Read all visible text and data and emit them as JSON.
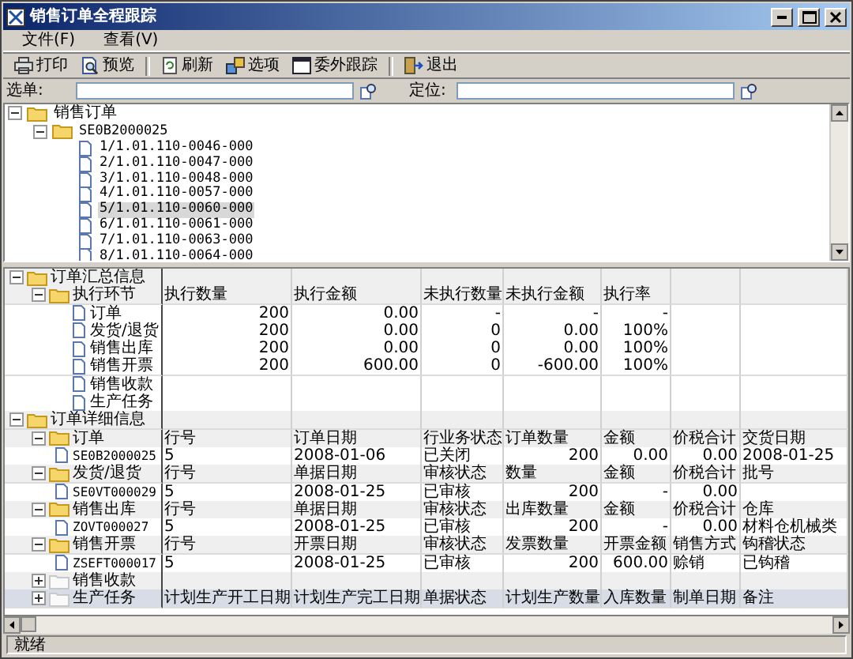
{
  "window": {
    "title": "销售订单全程跟踪"
  },
  "menu": [
    "文件(F)",
    "查看(V)"
  ],
  "toolbar": [
    {
      "label": "打印",
      "kind": "print"
    },
    {
      "label": "预览",
      "kind": "preview"
    },
    {
      "label": "刷新",
      "kind": "refresh"
    },
    {
      "label": "选项",
      "kind": "options"
    },
    {
      "label": "委外跟踪",
      "kind": "track"
    },
    {
      "label": "退出",
      "kind": "exit"
    }
  ],
  "filter": {
    "order_label": "选单:",
    "locate_label": "定位:"
  },
  "order_tree": {
    "label": "销售订单",
    "expanded": true,
    "children": [
      {
        "label": "SE0B2000025",
        "expanded": true,
        "children": [
          {
            "label": "1/1.01.110-0046-000",
            "selected": false
          },
          {
            "label": "2/1.01.110-0047-000",
            "selected": false
          },
          {
            "label": "3/1.01.110-0048-000",
            "selected": false
          },
          {
            "label": "4/1.01.110-0057-000",
            "selected": false
          },
          {
            "label": "5/1.01.110-0060-000",
            "selected": true
          },
          {
            "label": "6/1.01.110-0061-000",
            "selected": false
          },
          {
            "label": "7/1.01.110-0063-000",
            "selected": false
          },
          {
            "label": "8/1.01.110-0064-000",
            "selected": false
          }
        ]
      }
    ]
  },
  "summary": {
    "label": "订单汇总信息",
    "expanded": true,
    "stage": {
      "label": "执行环节",
      "expanded": true,
      "columns": [
        {
          "label": "执行数量",
          "numeric": true
        },
        {
          "label": "执行金额",
          "numeric": true
        },
        {
          "label": "未执行数量",
          "numeric": true
        },
        {
          "label": "未执行金额",
          "numeric": true
        },
        {
          "label": "执行率",
          "numeric": true
        }
      ],
      "rows": [
        {
          "label": "订单",
          "cells": [
            "200",
            "0.00",
            "-",
            "-",
            "-"
          ]
        },
        {
          "label": "发货/退货",
          "cells": [
            "200",
            "0.00",
            "0",
            "0.00",
            "100%"
          ]
        },
        {
          "label": "销售出库",
          "cells": [
            "200",
            "0.00",
            "0",
            "0.00",
            "100%"
          ]
        },
        {
          "label": "销售开票",
          "cells": [
            "200",
            "600.00",
            "0",
            "-600.00",
            "100%"
          ]
        },
        {
          "label": "销售收款"
        },
        {
          "label": "生产任务"
        }
      ]
    }
  },
  "details": {
    "label": "订单详细信息",
    "expanded": true,
    "groups": [
      {
        "label": "订单",
        "expanded": true,
        "selected": false,
        "columns": [
          {
            "label": "行号",
            "numeric": false
          },
          {
            "label": "订单日期",
            "numeric": false
          },
          {
            "label": "行业务状态",
            "numeric": false
          },
          {
            "label": "订单数量",
            "numeric": true
          },
          {
            "label": "金额",
            "numeric": true
          },
          {
            "label": "价税合计",
            "numeric": true
          },
          {
            "label": "交货日期",
            "numeric": false
          }
        ],
        "records": [
          {
            "label": "SE0B2000025",
            "cells": [
              "5",
              "2008-01-06",
              "已关闭",
              "200",
              "0.00",
              "0.00",
              "2008-01-25"
            ]
          }
        ]
      },
      {
        "label": "发货/退货",
        "expanded": true,
        "selected": false,
        "columns": [
          {
            "label": "行号",
            "numeric": false
          },
          {
            "label": "单据日期",
            "numeric": false
          },
          {
            "label": "审核状态",
            "numeric": false
          },
          {
            "label": "数量",
            "numeric": true
          },
          {
            "label": "金额",
            "numeric": true
          },
          {
            "label": "价税合计",
            "numeric": true
          },
          {
            "label": "批号",
            "numeric": false
          }
        ],
        "records": [
          {
            "label": "SE0VT000029",
            "cells": [
              "5",
              "2008-01-25",
              "已审核",
              "200",
              "-",
              "0.00",
              null
            ]
          }
        ]
      },
      {
        "label": "销售出库",
        "expanded": true,
        "selected": false,
        "columns": [
          {
            "label": "行号",
            "numeric": false
          },
          {
            "label": "单据日期",
            "numeric": false
          },
          {
            "label": "审核状态",
            "numeric": false
          },
          {
            "label": "出库数量",
            "numeric": true
          },
          {
            "label": "金额",
            "numeric": true
          },
          {
            "label": "价税合计",
            "numeric": true
          },
          {
            "label": "仓库",
            "numeric": false
          }
        ],
        "records": [
          {
            "label": "ZOVT000027",
            "cells": [
              "5",
              "2008-01-25",
              "已审核",
              "200",
              "-",
              "0.00",
              "材料仓机械类"
            ]
          }
        ]
      },
      {
        "label": "销售开票",
        "expanded": true,
        "selected": false,
        "columns": [
          {
            "label": "行号",
            "numeric": false
          },
          {
            "label": "开票日期",
            "numeric": false
          },
          {
            "label": "审核状态",
            "numeric": false
          },
          {
            "label": "发票数量",
            "numeric": true
          },
          {
            "label": "开票金额",
            "numeric": true
          },
          {
            "label": "销售方式",
            "numeric": false
          },
          {
            "label": "钩稽状态",
            "numeric": false
          }
        ],
        "records": [
          {
            "label": "ZSEFT000017",
            "cells": [
              "5",
              "2008-01-25",
              "已审核",
              "200",
              "600.00",
              "赊销",
              "已钩稽"
            ]
          }
        ]
      },
      {
        "label": "销售收款",
        "expanded": false,
        "selected": false
      },
      {
        "label": "生产任务",
        "expanded": false,
        "selected": true,
        "columns": [
          {
            "label": "计划生产开工日期",
            "numeric": false
          },
          {
            "label": "计划生产完工日期",
            "numeric": false
          },
          {
            "label": "单据状态",
            "numeric": false
          },
          {
            "label": "计划生产数量",
            "numeric": false
          },
          {
            "label": "入库数量",
            "numeric": false
          },
          {
            "label": "制单日期",
            "numeric": false
          },
          {
            "label": "备注",
            "numeric": false
          }
        ]
      }
    ]
  },
  "status_bar": "就绪"
}
